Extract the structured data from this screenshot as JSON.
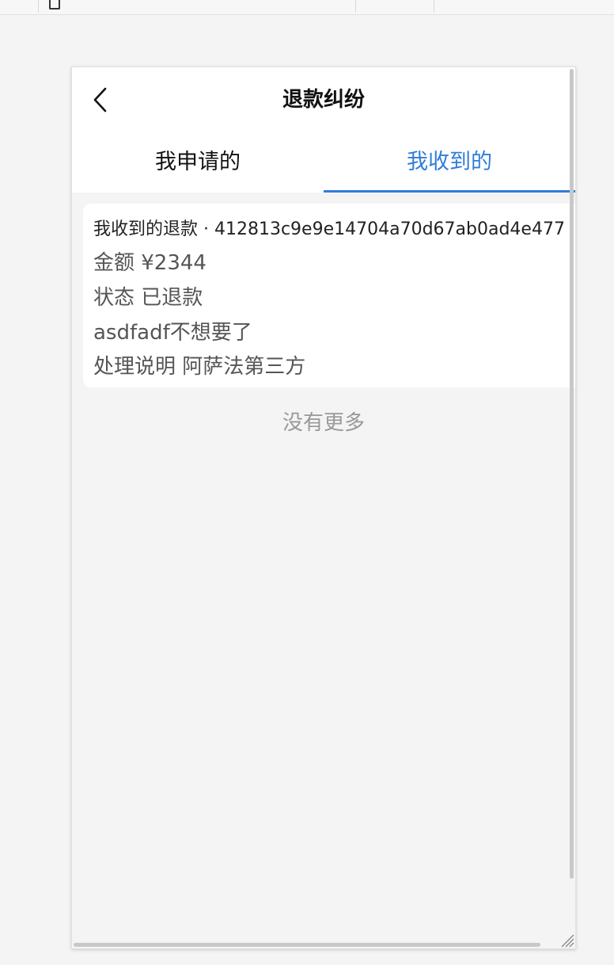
{
  "devtools": {
    "segments": [
      "",
      "",
      "",
      "",
      ""
    ]
  },
  "nav": {
    "title": "退款纠纷",
    "back_icon": "chevron-left-icon"
  },
  "tabs": [
    {
      "label": "我申请的",
      "active": false
    },
    {
      "label": "我收到的",
      "active": true
    }
  ],
  "accent_color": "#2f7dd8",
  "refund_item": {
    "title": "我收到的退款 · 412813c9e9e14704a70d67ab0ad4e477",
    "amount": "金额 ¥2344",
    "status": "状态 已退款",
    "reason": "asdfadf不想要了",
    "handling_note": "处理说明 阿萨法第三方"
  },
  "list_footer": "没有更多"
}
